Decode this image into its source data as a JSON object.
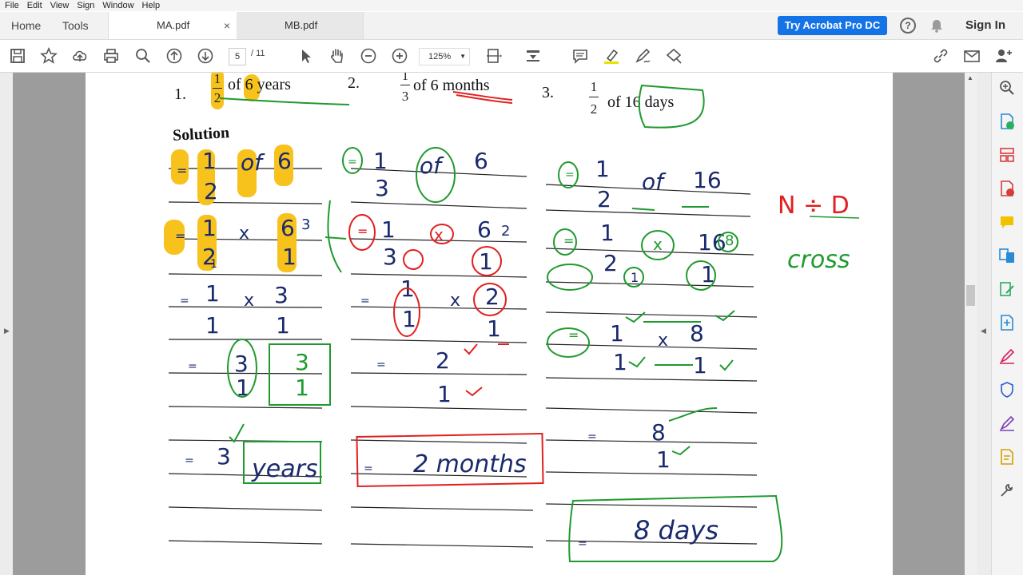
{
  "menu": [
    "File",
    "Edit",
    "View",
    "Sign",
    "Window",
    "Help"
  ],
  "tabs": {
    "home": "Home",
    "tools": "Tools",
    "documents": [
      {
        "name": "MA.pdf",
        "close": "×"
      },
      {
        "name": "MB.pdf"
      }
    ]
  },
  "header_actions": {
    "try_pro": "Try Acrobat Pro DC",
    "help": "?",
    "sign_in": "Sign In"
  },
  "toolbar": {
    "page_current": "5",
    "page_total": "/ 11",
    "zoom": "125%",
    "icons": [
      "save-icon",
      "star-icon",
      "upload-icon",
      "print-icon",
      "search-icon",
      "page-up-icon",
      "page-down-icon",
      "select-icon",
      "hand-icon",
      "zoom-out-icon",
      "zoom-in-icon",
      "fit-page-icon",
      "scroll-mode-icon",
      "comment-icon",
      "highlight-icon",
      "draw-icon",
      "stamp-icon",
      "link-icon",
      "mail-icon",
      "add-user-icon"
    ]
  },
  "worksheet": {
    "problems": [
      {
        "number": "1.",
        "numerator": "1",
        "denominator": "2",
        "text": "of 6 years"
      },
      {
        "number": "2.",
        "numerator": "1",
        "denominator": "3",
        "text": "of 6 months"
      },
      {
        "number": "3.",
        "numerator": "1",
        "denominator": "2",
        "text": "of 16 days"
      }
    ],
    "solution_label": "Solution",
    "answers": [
      "3 years",
      "2 months",
      "8 days"
    ],
    "side_note": [
      "N ÷ D",
      "cross"
    ],
    "colors": {
      "highlight": "#f7c21c",
      "green_pen": "#1f9a2e",
      "red_pen": "#e02020",
      "blue_pen": "#1a2a6c"
    }
  },
  "right_panel_icons": [
    "zoom-icon",
    "export-pdf-icon",
    "organize-pages-icon",
    "create-pdf-icon",
    "comment-panel-icon",
    "combine-files-icon",
    "edit-pdf-icon",
    "compress-icon",
    "fill-sign-icon",
    "protect-icon",
    "request-signature-icon",
    "send-for-review-icon",
    "more-tools-icon"
  ]
}
